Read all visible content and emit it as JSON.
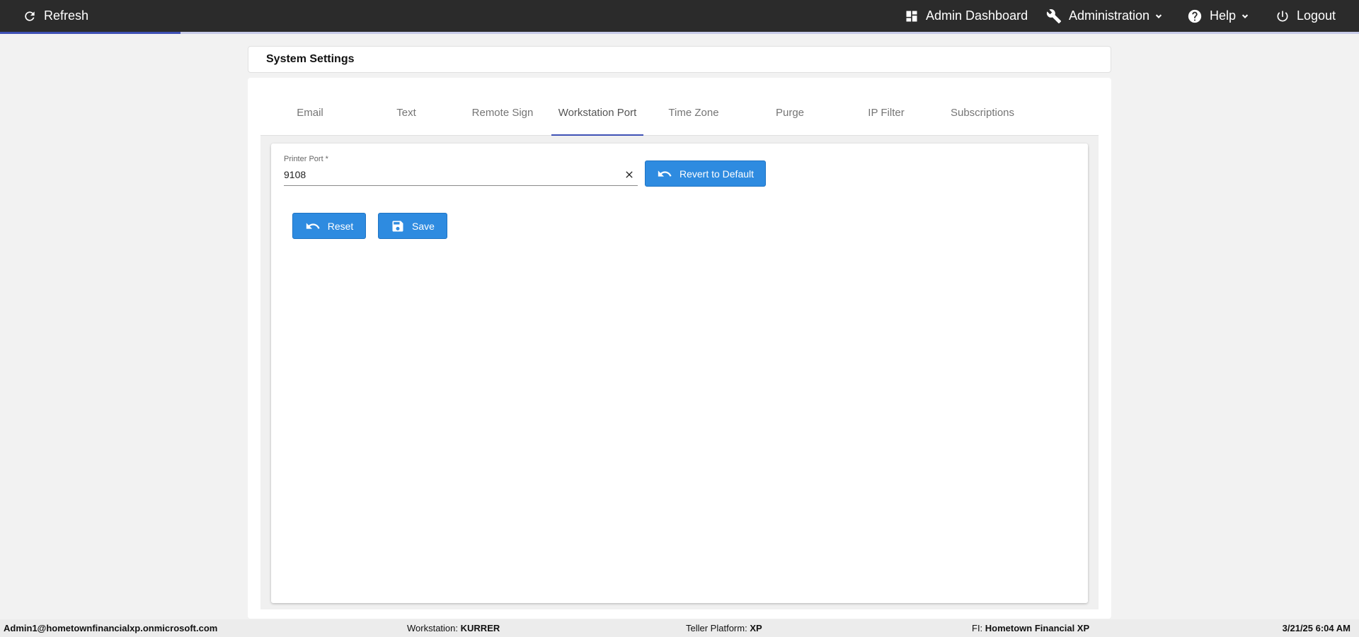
{
  "topbar": {
    "refresh_label": "Refresh",
    "admin_dashboard_label": "Admin Dashboard",
    "administration_label": "Administration",
    "help_label": "Help",
    "logout_label": "Logout",
    "progress_fraction": 0.133
  },
  "page": {
    "title": "System Settings"
  },
  "tabs": [
    {
      "label": "Email",
      "active": false
    },
    {
      "label": "Text",
      "active": false
    },
    {
      "label": "Remote Sign",
      "active": false
    },
    {
      "label": "Workstation Port",
      "active": true
    },
    {
      "label": "Time Zone",
      "active": false
    },
    {
      "label": "Purge",
      "active": false
    },
    {
      "label": "IP Filter",
      "active": false
    },
    {
      "label": "Subscriptions",
      "active": false
    }
  ],
  "form": {
    "printer_port_label": "Printer Port *",
    "printer_port_value": "9108",
    "revert_label": "Revert to Default",
    "reset_label": "Reset",
    "save_label": "Save"
  },
  "footer": {
    "user": "Admin1@hometownfinancialxp.onmicrosoft.com",
    "workstation_label": "Workstation:",
    "workstation_value": "KURRER",
    "platform_label": "Teller Platform:",
    "platform_value": "XP",
    "fi_label": "FI:",
    "fi_value": "Hometown Financial XP",
    "datetime": "3/21/25 6:04 AM"
  },
  "colors": {
    "topbar_bg": "#2b2b2b",
    "accent": "#3f51b5",
    "button_blue": "#2e8be0"
  }
}
